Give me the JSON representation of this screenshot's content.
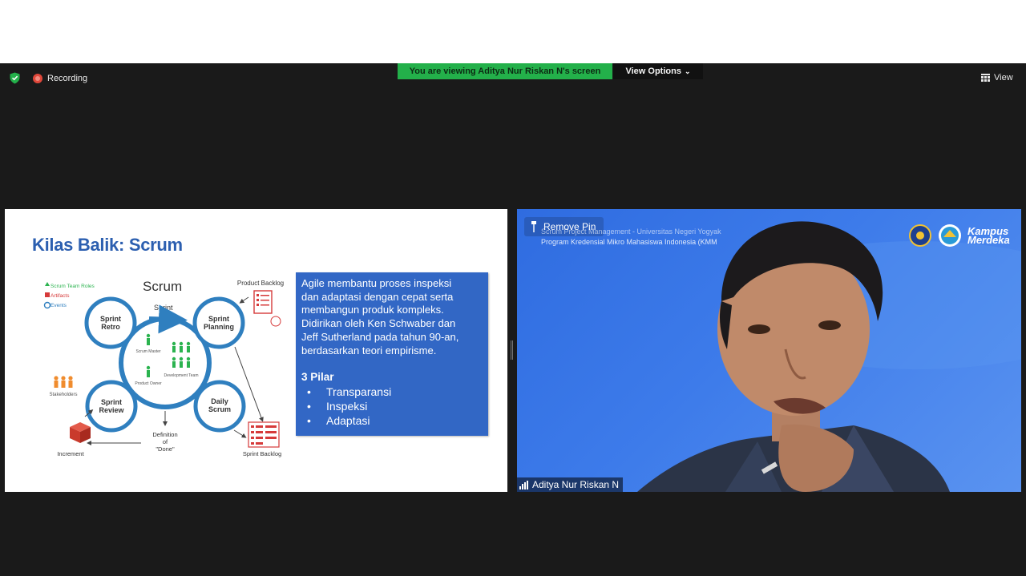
{
  "topbar": {
    "recording_label": "Recording",
    "viewing_banner": "You are viewing Aditya Nur Riskan N's screen",
    "view_options_label": "View Options",
    "view_label": "View"
  },
  "colors": {
    "banner": "#23b04a",
    "slide_title": "#2c5fb0",
    "textbox": "#3267c5",
    "diagram_blue": "#2f7fbf",
    "roles_green": "#2bb34f",
    "artifacts_red": "#d63a3a",
    "stakeholders_orange": "#f08c2e"
  },
  "slide": {
    "title": "Kilas Balik: Scrum",
    "diagram": {
      "heading": "Scrum",
      "legend": [
        "Scrum Team Roles",
        "Artifacts",
        "Events"
      ],
      "sprint_label": "Sprint",
      "events": [
        "Sprint Retro",
        "Sprint Planning",
        "Sprint Review",
        "Daily Scrum"
      ],
      "roles": [
        "Scrum Master",
        "Development Team",
        "Product Owner"
      ],
      "stakeholders": "Stakeholders",
      "product_backlog": "Product Backlog",
      "sprint_backlog": "Sprint Backlog",
      "increment": "Increment",
      "definition_done": [
        "Definition",
        "of",
        "\"Done\""
      ]
    },
    "textbox": {
      "paragraph_lines": [
        "Agile membantu proses inspeksi",
        "dan adaptasi dengan cepat serta",
        "membangun produk kompleks.",
        "Didirikan oleh Ken Schwaber dan",
        "Jeff Sutherland pada tahun 90-an,",
        "berdasarkan teori empirisme."
      ],
      "pilar_title": "3 Pilar",
      "pillars": [
        "Transparansi",
        "Inspeksi",
        "Adaptasi"
      ]
    }
  },
  "video": {
    "remove_pin_label": "Remove Pin",
    "overlay_line1": "Scrum Project Management - Universitas Negeri Yogyak",
    "overlay_line2": "Program Kredensial Mikro Mahasiswa Indonesia (KMM",
    "logo_text_1": "Kampus",
    "logo_text_2": "Merdeka",
    "participant_name": "Aditya Nur Riskan N"
  }
}
